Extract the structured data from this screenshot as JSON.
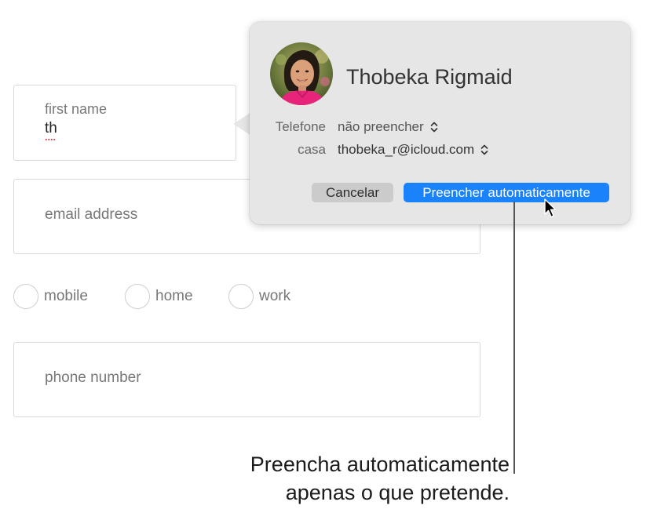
{
  "form": {
    "first_name": {
      "label": "first name",
      "value": "th"
    },
    "email": {
      "placeholder": "email address"
    },
    "contact_type": {
      "options": [
        "mobile",
        "home",
        "work"
      ]
    },
    "phone": {
      "placeholder": "phone number"
    }
  },
  "autofill": {
    "contact_name": "Thobeka Rigmaid",
    "rows": [
      {
        "key": "Telefone",
        "value": "não preencher"
      },
      {
        "key": "casa",
        "value": "thobeka_r@icloud.com"
      }
    ],
    "cancel_label": "Cancelar",
    "fill_label": "Preencher automaticamente",
    "accent_color": "#1a82fb"
  },
  "callout": {
    "line1": "Preencha automaticamente",
    "line2": "apenas o que pretende."
  },
  "icons": [
    "avatar-photo",
    "chevron-updown-icon",
    "mouse-cursor-icon"
  ]
}
